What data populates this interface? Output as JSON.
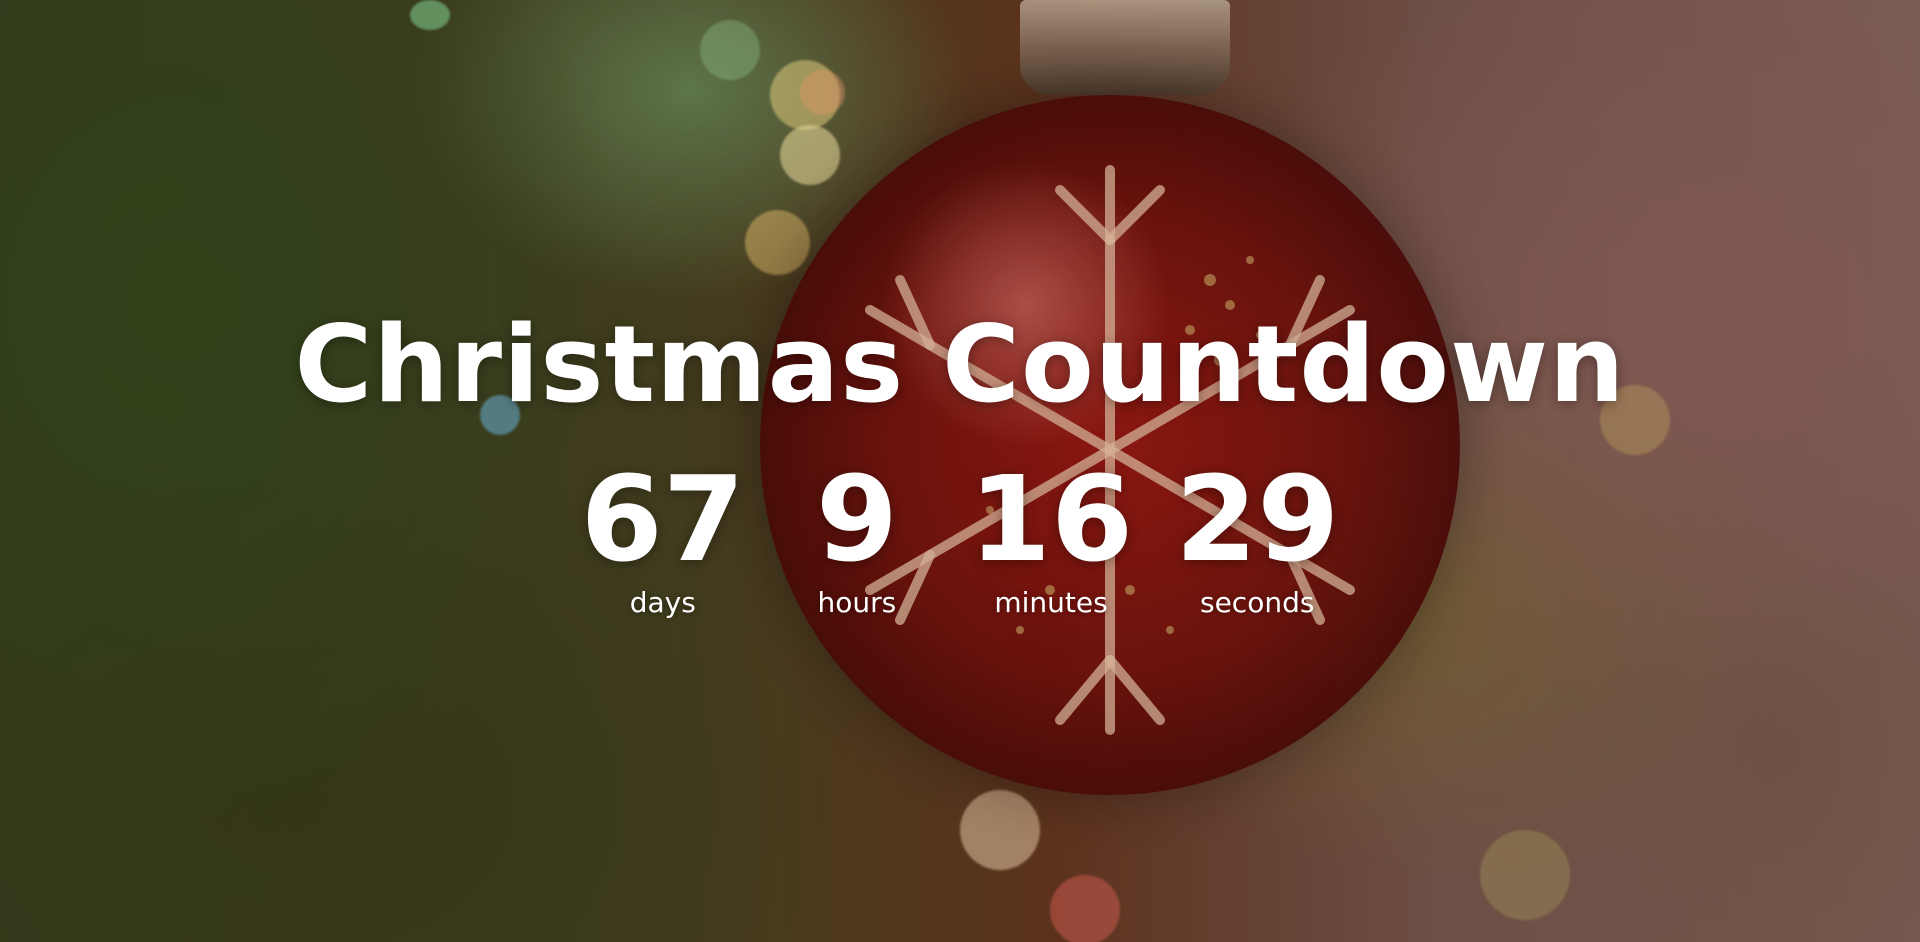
{
  "page": {
    "title": "Christmas Countdown"
  },
  "countdown": {
    "units": [
      {
        "value": "67",
        "label": "days"
      },
      {
        "value": "9",
        "label": "hours"
      },
      {
        "value": "16",
        "label": "minutes"
      },
      {
        "value": "29",
        "label": "seconds"
      }
    ]
  },
  "background": {
    "ornament_color": "#a01a12",
    "text_color": "#ffffff"
  }
}
